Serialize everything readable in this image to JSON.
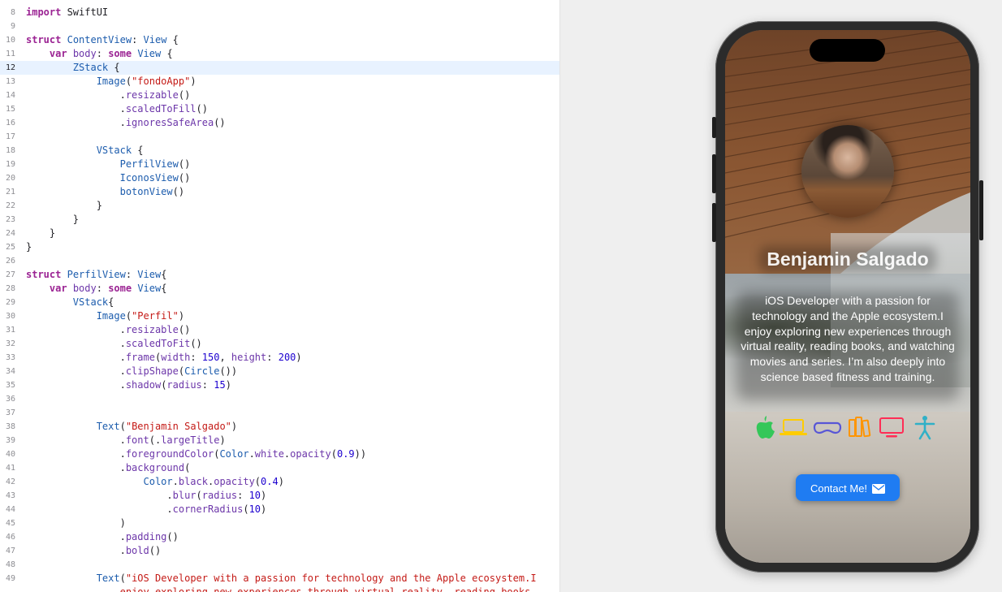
{
  "editor": {
    "current_line": "12",
    "lines": [
      {
        "num": "8",
        "tokens": [
          [
            "kw",
            "import"
          ],
          [
            "plain",
            " SwiftUI"
          ]
        ]
      },
      {
        "num": "9",
        "tokens": []
      },
      {
        "num": "10",
        "tokens": [
          [
            "kw",
            "struct"
          ],
          [
            "plain",
            " "
          ],
          [
            "type",
            "ContentView"
          ],
          [
            "plain",
            ": "
          ],
          [
            "type",
            "View"
          ],
          [
            "plain",
            " {"
          ]
        ]
      },
      {
        "num": "11",
        "tokens": [
          [
            "plain",
            "    "
          ],
          [
            "kw",
            "var"
          ],
          [
            "plain",
            " "
          ],
          [
            "member",
            "body"
          ],
          [
            "plain",
            ": "
          ],
          [
            "kw",
            "some"
          ],
          [
            "plain",
            " "
          ],
          [
            "type",
            "View"
          ],
          [
            "plain",
            " {"
          ]
        ]
      },
      {
        "num": "12",
        "tokens": [
          [
            "plain",
            "        "
          ],
          [
            "type",
            "ZStack"
          ],
          [
            "plain",
            " {"
          ]
        ]
      },
      {
        "num": "13",
        "tokens": [
          [
            "plain",
            "            "
          ],
          [
            "type",
            "Image"
          ],
          [
            "plain",
            "("
          ],
          [
            "string",
            "\"fondoApp\""
          ],
          [
            "plain",
            ")"
          ]
        ]
      },
      {
        "num": "14",
        "tokens": [
          [
            "plain",
            "                ."
          ],
          [
            "member",
            "resizable"
          ],
          [
            "plain",
            "()"
          ]
        ]
      },
      {
        "num": "15",
        "tokens": [
          [
            "plain",
            "                ."
          ],
          [
            "member",
            "scaledToFill"
          ],
          [
            "plain",
            "()"
          ]
        ]
      },
      {
        "num": "16",
        "tokens": [
          [
            "plain",
            "                ."
          ],
          [
            "member",
            "ignoresSafeArea"
          ],
          [
            "plain",
            "()"
          ]
        ]
      },
      {
        "num": "17",
        "tokens": []
      },
      {
        "num": "18",
        "tokens": [
          [
            "plain",
            "            "
          ],
          [
            "type",
            "VStack"
          ],
          [
            "plain",
            " {"
          ]
        ]
      },
      {
        "num": "19",
        "tokens": [
          [
            "plain",
            "                "
          ],
          [
            "type",
            "PerfilView"
          ],
          [
            "plain",
            "()"
          ]
        ]
      },
      {
        "num": "20",
        "tokens": [
          [
            "plain",
            "                "
          ],
          [
            "type",
            "IconosView"
          ],
          [
            "plain",
            "()"
          ]
        ]
      },
      {
        "num": "21",
        "tokens": [
          [
            "plain",
            "                "
          ],
          [
            "type",
            "botonView"
          ],
          [
            "plain",
            "()"
          ]
        ]
      },
      {
        "num": "22",
        "tokens": [
          [
            "plain",
            "            }"
          ]
        ]
      },
      {
        "num": "23",
        "tokens": [
          [
            "plain",
            "        }"
          ]
        ]
      },
      {
        "num": "24",
        "tokens": [
          [
            "plain",
            "    }"
          ]
        ]
      },
      {
        "num": "25",
        "tokens": [
          [
            "plain",
            "}"
          ]
        ]
      },
      {
        "num": "26",
        "tokens": []
      },
      {
        "num": "27",
        "tokens": [
          [
            "kw",
            "struct"
          ],
          [
            "plain",
            " "
          ],
          [
            "type",
            "PerfilView"
          ],
          [
            "plain",
            ": "
          ],
          [
            "type",
            "View"
          ],
          [
            "plain",
            "{"
          ]
        ]
      },
      {
        "num": "28",
        "tokens": [
          [
            "plain",
            "    "
          ],
          [
            "kw",
            "var"
          ],
          [
            "plain",
            " "
          ],
          [
            "member",
            "body"
          ],
          [
            "plain",
            ": "
          ],
          [
            "kw",
            "some"
          ],
          [
            "plain",
            " "
          ],
          [
            "type",
            "View"
          ],
          [
            "plain",
            "{"
          ]
        ]
      },
      {
        "num": "29",
        "tokens": [
          [
            "plain",
            "        "
          ],
          [
            "type",
            "VStack"
          ],
          [
            "plain",
            "{"
          ]
        ]
      },
      {
        "num": "30",
        "tokens": [
          [
            "plain",
            "            "
          ],
          [
            "type",
            "Image"
          ],
          [
            "plain",
            "("
          ],
          [
            "string",
            "\"Perfil\""
          ],
          [
            "plain",
            ")"
          ]
        ]
      },
      {
        "num": "31",
        "tokens": [
          [
            "plain",
            "                ."
          ],
          [
            "member",
            "resizable"
          ],
          [
            "plain",
            "()"
          ]
        ]
      },
      {
        "num": "32",
        "tokens": [
          [
            "plain",
            "                ."
          ],
          [
            "member",
            "scaledToFit"
          ],
          [
            "plain",
            "()"
          ]
        ]
      },
      {
        "num": "33",
        "tokens": [
          [
            "plain",
            "                ."
          ],
          [
            "member",
            "frame"
          ],
          [
            "plain",
            "("
          ],
          [
            "member",
            "width"
          ],
          [
            "plain",
            ": "
          ],
          [
            "number",
            "150"
          ],
          [
            "plain",
            ", "
          ],
          [
            "member",
            "height"
          ],
          [
            "plain",
            ": "
          ],
          [
            "number",
            "200"
          ],
          [
            "plain",
            ")"
          ]
        ]
      },
      {
        "num": "34",
        "tokens": [
          [
            "plain",
            "                ."
          ],
          [
            "member",
            "clipShape"
          ],
          [
            "plain",
            "("
          ],
          [
            "type",
            "Circle"
          ],
          [
            "plain",
            "())"
          ]
        ]
      },
      {
        "num": "35",
        "tokens": [
          [
            "plain",
            "                ."
          ],
          [
            "member",
            "shadow"
          ],
          [
            "plain",
            "("
          ],
          [
            "member",
            "radius"
          ],
          [
            "plain",
            ": "
          ],
          [
            "number",
            "15"
          ],
          [
            "plain",
            ")"
          ]
        ]
      },
      {
        "num": "36",
        "tokens": []
      },
      {
        "num": "37",
        "tokens": []
      },
      {
        "num": "38",
        "tokens": [
          [
            "plain",
            "            "
          ],
          [
            "type",
            "Text"
          ],
          [
            "plain",
            "("
          ],
          [
            "string",
            "\"Benjamin Salgado\""
          ],
          [
            "plain",
            ")"
          ]
        ]
      },
      {
        "num": "39",
        "tokens": [
          [
            "plain",
            "                ."
          ],
          [
            "member",
            "font"
          ],
          [
            "plain",
            "(."
          ],
          [
            "member",
            "largeTitle"
          ],
          [
            "plain",
            ")"
          ]
        ]
      },
      {
        "num": "40",
        "tokens": [
          [
            "plain",
            "                ."
          ],
          [
            "member",
            "foregroundColor"
          ],
          [
            "plain",
            "("
          ],
          [
            "type",
            "Color"
          ],
          [
            "plain",
            "."
          ],
          [
            "member",
            "white"
          ],
          [
            "plain",
            "."
          ],
          [
            "member",
            "opacity"
          ],
          [
            "plain",
            "("
          ],
          [
            "number",
            "0.9"
          ],
          [
            "plain",
            "))"
          ]
        ]
      },
      {
        "num": "41",
        "tokens": [
          [
            "plain",
            "                ."
          ],
          [
            "member",
            "background"
          ],
          [
            "plain",
            "("
          ]
        ]
      },
      {
        "num": "42",
        "tokens": [
          [
            "plain",
            "                    "
          ],
          [
            "type",
            "Color"
          ],
          [
            "plain",
            "."
          ],
          [
            "member",
            "black"
          ],
          [
            "plain",
            "."
          ],
          [
            "member",
            "opacity"
          ],
          [
            "plain",
            "("
          ],
          [
            "number",
            "0.4"
          ],
          [
            "plain",
            ")"
          ]
        ]
      },
      {
        "num": "43",
        "tokens": [
          [
            "plain",
            "                        ."
          ],
          [
            "member",
            "blur"
          ],
          [
            "plain",
            "("
          ],
          [
            "member",
            "radius"
          ],
          [
            "plain",
            ": "
          ],
          [
            "number",
            "10"
          ],
          [
            "plain",
            ")"
          ]
        ]
      },
      {
        "num": "44",
        "tokens": [
          [
            "plain",
            "                        ."
          ],
          [
            "member",
            "cornerRadius"
          ],
          [
            "plain",
            "("
          ],
          [
            "number",
            "10"
          ],
          [
            "plain",
            ")"
          ]
        ]
      },
      {
        "num": "45",
        "tokens": [
          [
            "plain",
            "                )"
          ]
        ]
      },
      {
        "num": "46",
        "tokens": [
          [
            "plain",
            "                ."
          ],
          [
            "member",
            "padding"
          ],
          [
            "plain",
            "()"
          ]
        ]
      },
      {
        "num": "47",
        "tokens": [
          [
            "plain",
            "                ."
          ],
          [
            "member",
            "bold"
          ],
          [
            "plain",
            "()"
          ]
        ]
      },
      {
        "num": "48",
        "tokens": []
      },
      {
        "num": "49",
        "tokens": [
          [
            "plain",
            "            "
          ],
          [
            "type",
            "Text"
          ],
          [
            "plain",
            "("
          ],
          [
            "string",
            "\"iOS Developer with a passion for technology and the Apple ecosystem.I"
          ]
        ]
      },
      {
        "num": "",
        "tokens": [
          [
            "string",
            "                enjoy exploring new experiences through virtual reality, reading books,"
          ]
        ]
      }
    ]
  },
  "preview": {
    "profile_name": "Benjamin Salgado",
    "bio": "iOS Developer with a passion for technology and the Apple ecosystem.I enjoy exploring new experiences through virtual reality, reading books, and watching movies and series. I’m also deeply into science based fitness and training.",
    "icons": [
      {
        "name": "apple-logo-icon",
        "color": "#34c759"
      },
      {
        "name": "laptop-icon",
        "color": "#ffcc00"
      },
      {
        "name": "vision-pro-headset-icon",
        "color": "#5856d6"
      },
      {
        "name": "books-icon",
        "color": "#ff9500"
      },
      {
        "name": "tv-icon",
        "color": "#ff2d55"
      },
      {
        "name": "fitness-figure-icon",
        "color": "#30b0c7"
      }
    ],
    "contact_button_label": "Contact Me!",
    "button_color": "#1f7cf2"
  }
}
